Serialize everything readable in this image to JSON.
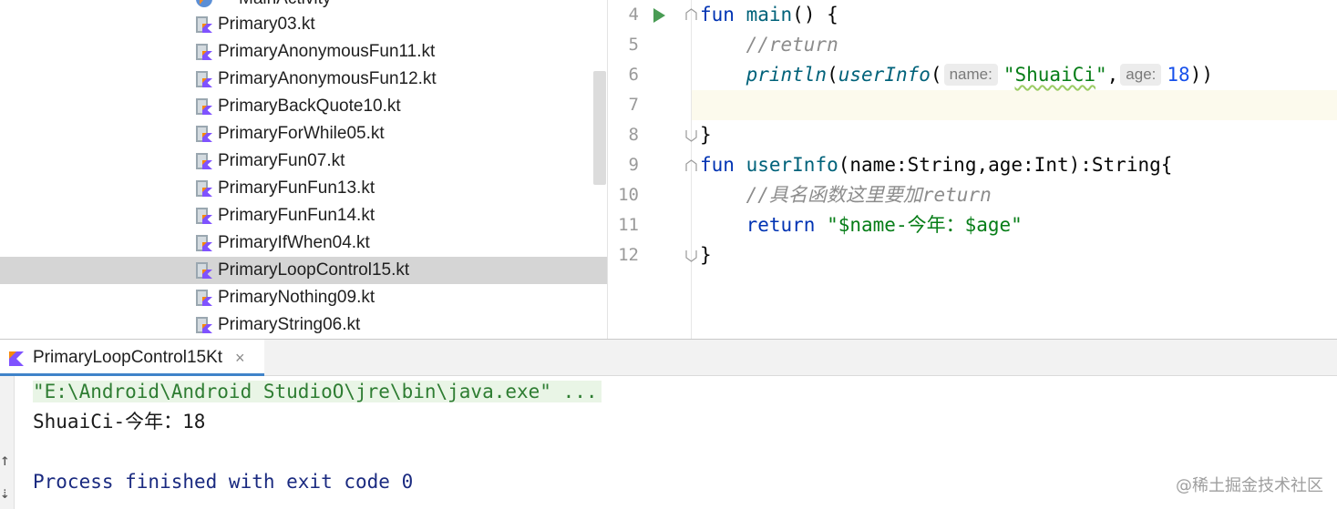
{
  "project_tree": {
    "partial_top_item": "MainActivity",
    "files": [
      {
        "label": "Primary03.kt"
      },
      {
        "label": "PrimaryAnonymousFun11.kt"
      },
      {
        "label": "PrimaryAnonymousFun12.kt"
      },
      {
        "label": "PrimaryBackQuote10.kt"
      },
      {
        "label": "PrimaryForWhile05.kt"
      },
      {
        "label": "PrimaryFun07.kt"
      },
      {
        "label": "PrimaryFunFun13.kt"
      },
      {
        "label": "PrimaryFunFun14.kt"
      },
      {
        "label": "PrimaryIfWhen04.kt"
      },
      {
        "label": "PrimaryLoopControl15.kt",
        "selected": true
      },
      {
        "label": "PrimaryNothing09.kt"
      },
      {
        "label": "PrimaryString06.kt"
      }
    ],
    "icon": "kotlin-file-icon"
  },
  "editor": {
    "line_numbers": [
      "4",
      "5",
      "6",
      "7",
      "8",
      "9",
      "10",
      "11",
      "12"
    ],
    "code": {
      "l4": {
        "kw": "fun",
        "fn": "main",
        "rest": "() {"
      },
      "l5": {
        "comment": "//return"
      },
      "l6": {
        "fn": "println",
        "open": "(",
        "call": "userInfo",
        "paren": "(",
        "hint_name": "name:",
        "str": "\"ShuaiCi\"",
        "comma": ",",
        "hint_age": "age:",
        "num": "18",
        "close": "))"
      },
      "l8": {
        "text": "}"
      },
      "l9": {
        "kw": "fun",
        "fn": "userInfo",
        "rest": "(name:String,age:Int):String{"
      },
      "l10": {
        "comment": "//具名函数这里要加return"
      },
      "l11": {
        "kw": "return",
        "str": "\"$name-今年：$age\""
      },
      "l12": {
        "text": "}"
      }
    }
  },
  "run_window": {
    "tab_label": "PrimaryLoopControl15Kt",
    "tab_close": "×",
    "console": [
      "\"E:\\Android\\Android StudioO\\jre\\bin\\java.exe\" ...",
      "ShuaiCi-今年：18",
      "",
      "Process finished with exit code 0"
    ]
  },
  "watermark": "@稀土掘金技术社区",
  "colors": {
    "keyword": "#0033b3",
    "function": "#00627a",
    "string": "#067d17",
    "number": "#1750eb",
    "comment": "#8c8c8c",
    "selection": "#d5d5d5",
    "current_line": "#fcfaed"
  }
}
